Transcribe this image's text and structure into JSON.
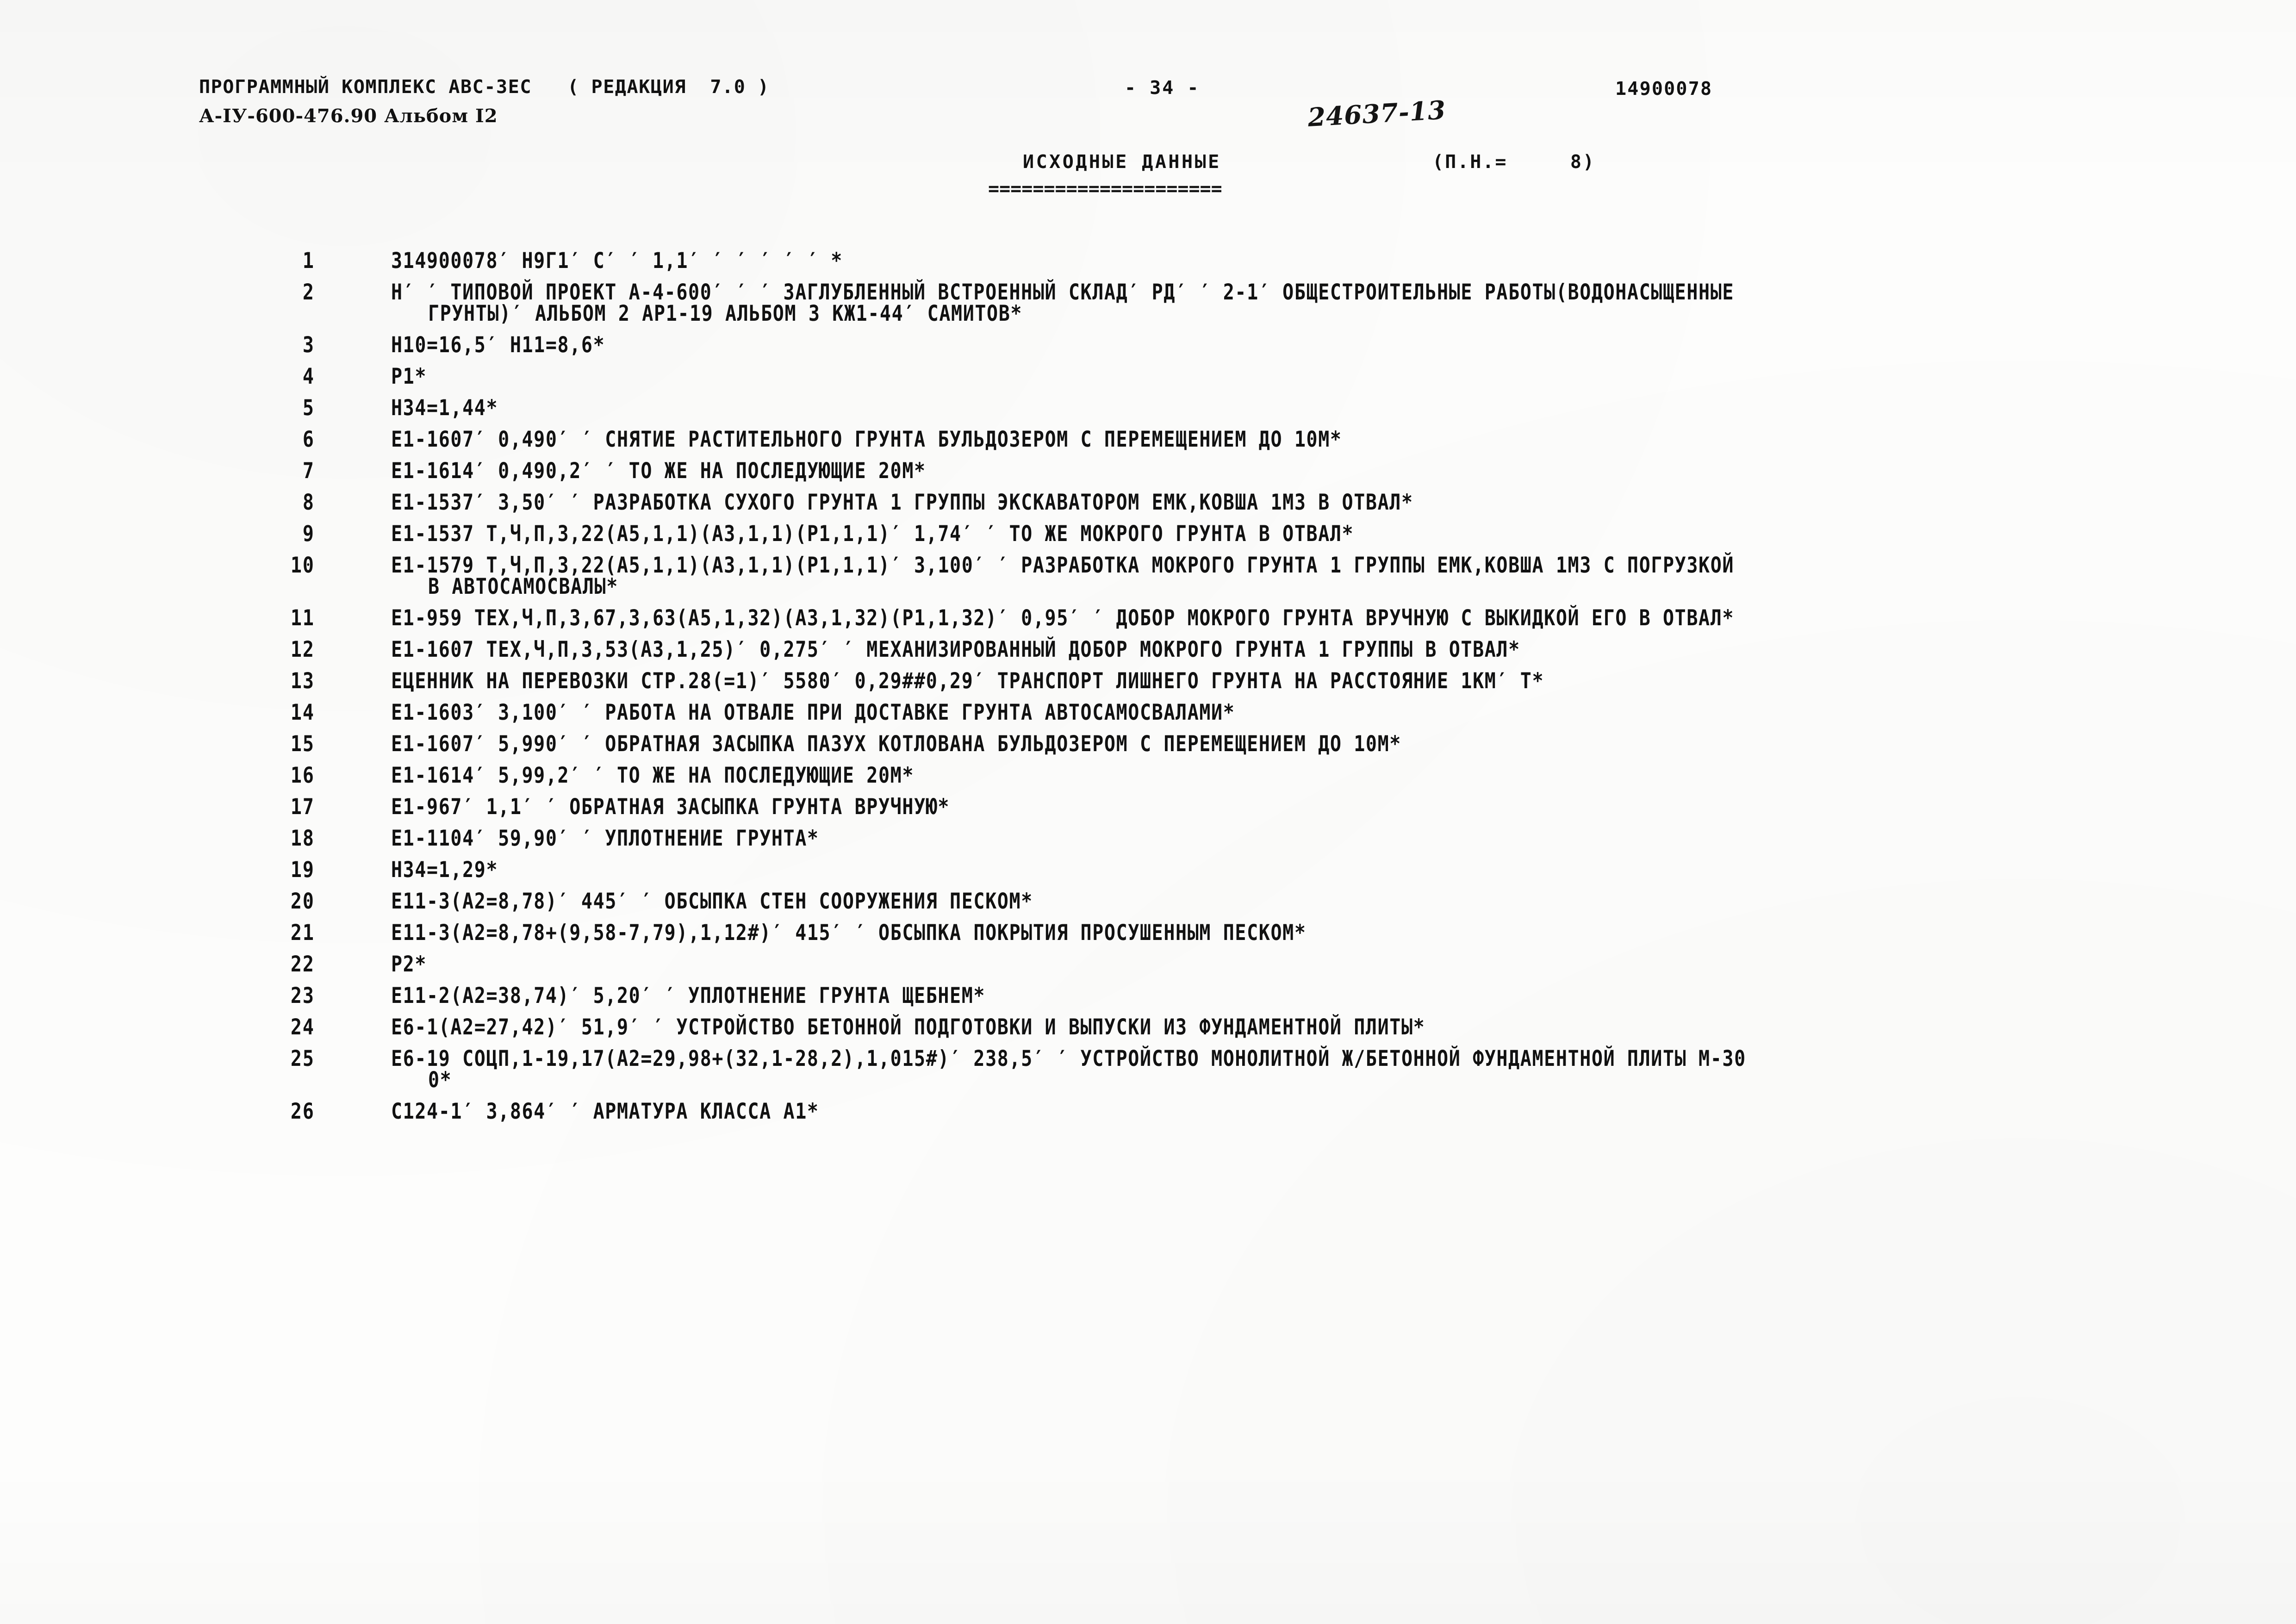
{
  "header": {
    "program_line": "ПРОГРАММНЫЙ КОМПЛЕКС АВС-3ЕС   ( РЕДАКЦИЯ  7.0 )",
    "album_line": "А-IУ-600-476.90 Альбом I2",
    "page_number": "- 34 -",
    "handwritten_note": "24637-13",
    "document_number": "14900078"
  },
  "section": {
    "title": "ИСХОДНЫЕ ДАННЫЕ",
    "rule": "=====================",
    "counter_label": "(П.Н.=",
    "counter_value": "8)",
    "counter_full": "(П.Н.=     8)"
  },
  "listing": {
    "rows": [
      {
        "index": "1",
        "text": "314900078′ Н9Г1′ С′ ′ 1,1′ ′ ′ ′ ′ ′ *",
        "continuation": ""
      },
      {
        "index": "2",
        "text": "Н′ ′ ТИПОВОЙ ПРОЕКТ А-4-600′ ′ ′ ЗАГЛУБЛЕННЫЙ ВСТРОЕННЫЙ СКЛАД′ РД′ ′ 2-1′ ОБЩЕСТРОИТЕЛЬНЫЕ РАБОТЫ(ВОДОНАСЫЩЕННЫЕ",
        "continuation": "ГРУНТЫ)′ АЛЬБОМ 2 АР1-19 АЛЬБОМ 3 КЖ1-44′ САМИТОВ*"
      },
      {
        "index": "3",
        "text": "Н10=16,5′ Н11=8,6*",
        "continuation": ""
      },
      {
        "index": "4",
        "text": "Р1*",
        "continuation": ""
      },
      {
        "index": "5",
        "text": "Н34=1,44*",
        "continuation": ""
      },
      {
        "index": "6",
        "text": "Е1-1607′ 0,490′ ′ СНЯТИЕ РАСТИТЕЛЬНОГО ГРУНТА БУЛЬДОЗЕРОМ С ПЕРЕМЕЩЕНИЕМ ДО 10М*",
        "continuation": ""
      },
      {
        "index": "7",
        "text": "Е1-1614′ 0,490,2′ ′ ТО ЖЕ НА ПОСЛЕДУЮЩИЕ 20М*",
        "continuation": ""
      },
      {
        "index": "8",
        "text": "Е1-1537′ 3,50′ ′ РАЗРАБОТКА СУХОГО ГРУНТА 1 ГРУППЫ ЭКСКАВАТОРОМ ЕМК,КОВША 1М3 В ОТВАЛ*",
        "continuation": ""
      },
      {
        "index": "9",
        "text": "Е1-1537 Т,Ч,П,3,22(А5,1,1)(А3,1,1)(Р1,1,1)′ 1,74′ ′ ТО ЖЕ МОКРОГО ГРУНТА В ОТВАЛ*",
        "continuation": ""
      },
      {
        "index": "10",
        "text": "Е1-1579 Т,Ч,П,3,22(А5,1,1)(А3,1,1)(Р1,1,1)′ 3,100′ ′ РАЗРАБОТКА МОКРОГО ГРУНТА 1 ГРУППЫ ЕМК,КОВША 1М3 С ПОГРУЗКОЙ",
        "continuation": "В АВТОСАМОСВАЛЫ*"
      },
      {
        "index": "11",
        "text": "Е1-959 ТЕХ,Ч,П,3,67,3,63(А5,1,32)(А3,1,32)(Р1,1,32)′ 0,95′ ′ ДОБОР МОКРОГО ГРУНТА ВРУЧНУЮ С ВЫКИДКОЙ ЕГО В ОТВАЛ*",
        "continuation": ""
      },
      {
        "index": "12",
        "text": "Е1-1607 ТЕХ,Ч,П,3,53(А3,1,25)′ 0,275′ ′ МЕХАНИЗИРОВАННЫЙ ДОБОР МОКРОГО ГРУНТА 1 ГРУППЫ В ОТВАЛ*",
        "continuation": ""
      },
      {
        "index": "13",
        "text": "ЕЦЕННИК НА ПЕРЕВОЗКИ СТР.28(=1)′ 5580′ 0,29##0,29′ ТРАНСПОРТ ЛИШНЕГО ГРУНТА НА РАССТОЯНИЕ 1КМ′ Т*",
        "continuation": ""
      },
      {
        "index": "14",
        "text": "Е1-1603′ 3,100′ ′ РАБОТА НА ОТВАЛЕ ПРИ ДОСТАВКЕ ГРУНТА АВТОСАМОСВАЛАМИ*",
        "continuation": ""
      },
      {
        "index": "15",
        "text": "Е1-1607′ 5,990′ ′ ОБРАТНАЯ ЗАСЫПКА ПАЗУХ КОТЛОВАНА БУЛЬДОЗЕРОМ С ПЕРЕМЕЩЕНИЕМ ДО 10М*",
        "continuation": ""
      },
      {
        "index": "16",
        "text": "Е1-1614′ 5,99,2′ ′ ТО ЖЕ НА ПОСЛЕДУЮЩИЕ 20М*",
        "continuation": ""
      },
      {
        "index": "17",
        "text": "Е1-967′ 1,1′ ′ ОБРАТНАЯ ЗАСЫПКА ГРУНТА ВРУЧНУЮ*",
        "continuation": ""
      },
      {
        "index": "18",
        "text": "Е1-1104′ 59,90′ ′ УПЛОТНЕНИЕ ГРУНТА*",
        "continuation": ""
      },
      {
        "index": "19",
        "text": "Н34=1,29*",
        "continuation": ""
      },
      {
        "index": "20",
        "text": "Е11-3(А2=8,78)′ 445′ ′ ОБСЫПКА СТЕН СООРУЖЕНИЯ ПЕСКОМ*",
        "continuation": ""
      },
      {
        "index": "21",
        "text": "Е11-3(А2=8,78+(9,58-7,79),1,12#)′ 415′ ′ ОБСЫПКА ПОКРЫТИЯ ПРОСУШЕННЫМ ПЕСКОМ*",
        "continuation": ""
      },
      {
        "index": "22",
        "text": "Р2*",
        "continuation": ""
      },
      {
        "index": "23",
        "text": "Е11-2(А2=38,74)′ 5,20′ ′ УПЛОТНЕНИЕ ГРУНТА ЩЕБНЕМ*",
        "continuation": ""
      },
      {
        "index": "24",
        "text": "Е6-1(А2=27,42)′ 51,9′ ′ УСТРОЙСТВО БЕТОННОЙ ПОДГОТОВКИ И ВЫПУСКИ ИЗ ФУНДАМЕНТНОЙ ПЛИТЫ*",
        "continuation": ""
      },
      {
        "index": "25",
        "text": "Е6-19 СОЦП,1-19,17(А2=29,98+(32,1-28,2),1,015#)′ 238,5′ ′ УСТРОЙСТВО МОНОЛИТНОЙ Ж/БЕТОННОЙ ФУНДАМЕНТНОЙ ПЛИТЫ М-30",
        "continuation": "0*"
      },
      {
        "index": "26",
        "text": "С124-1′ 3,864′ ′ АРМАТУРА КЛАССА А1*",
        "continuation": ""
      }
    ]
  }
}
